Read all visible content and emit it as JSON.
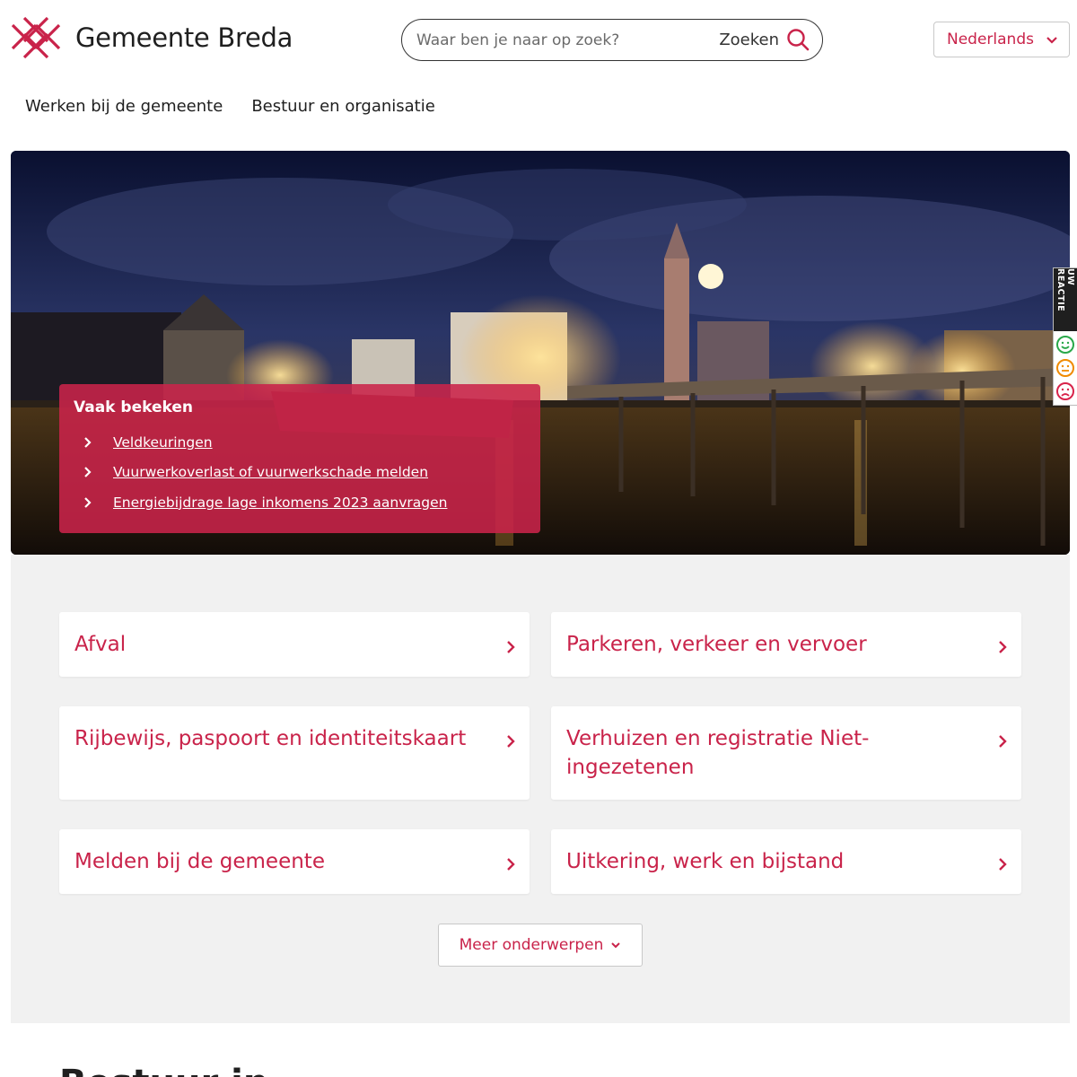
{
  "header": {
    "logo_text": "Gemeente Breda",
    "search_placeholder": "Waar ben je naar op zoek?",
    "search_button": "Zoeken",
    "language": "Nederlands"
  },
  "nav": {
    "items": [
      {
        "label": "Werken bij de gemeente"
      },
      {
        "label": "Bestuur en organisatie"
      }
    ]
  },
  "hero": {
    "box_title": "Vaak bekeken",
    "links": [
      {
        "label": "Veldkeuringen"
      },
      {
        "label": "Vuurwerkoverlast of vuurwerkschade melden"
      },
      {
        "label": "Energiebijdrage lage inkomens 2023 aanvragen"
      }
    ]
  },
  "feedback": {
    "label": "UW REACTIE"
  },
  "topics": {
    "items": [
      {
        "label": "Afval"
      },
      {
        "label": "Parkeren, verkeer en vervoer"
      },
      {
        "label": "Rijbewijs, paspoort en identiteitskaart"
      },
      {
        "label": "Verhuizen en registratie Niet-ingezetenen"
      },
      {
        "label": "Melden bij de gemeente"
      },
      {
        "label": "Uitkering, werk en bijstand"
      }
    ],
    "more_button": "Meer onderwerpen"
  },
  "bottom": {
    "heading": "Bestuur in"
  },
  "colors": {
    "brand": "#c9234a",
    "panel_bg": "#f1f1f1"
  }
}
